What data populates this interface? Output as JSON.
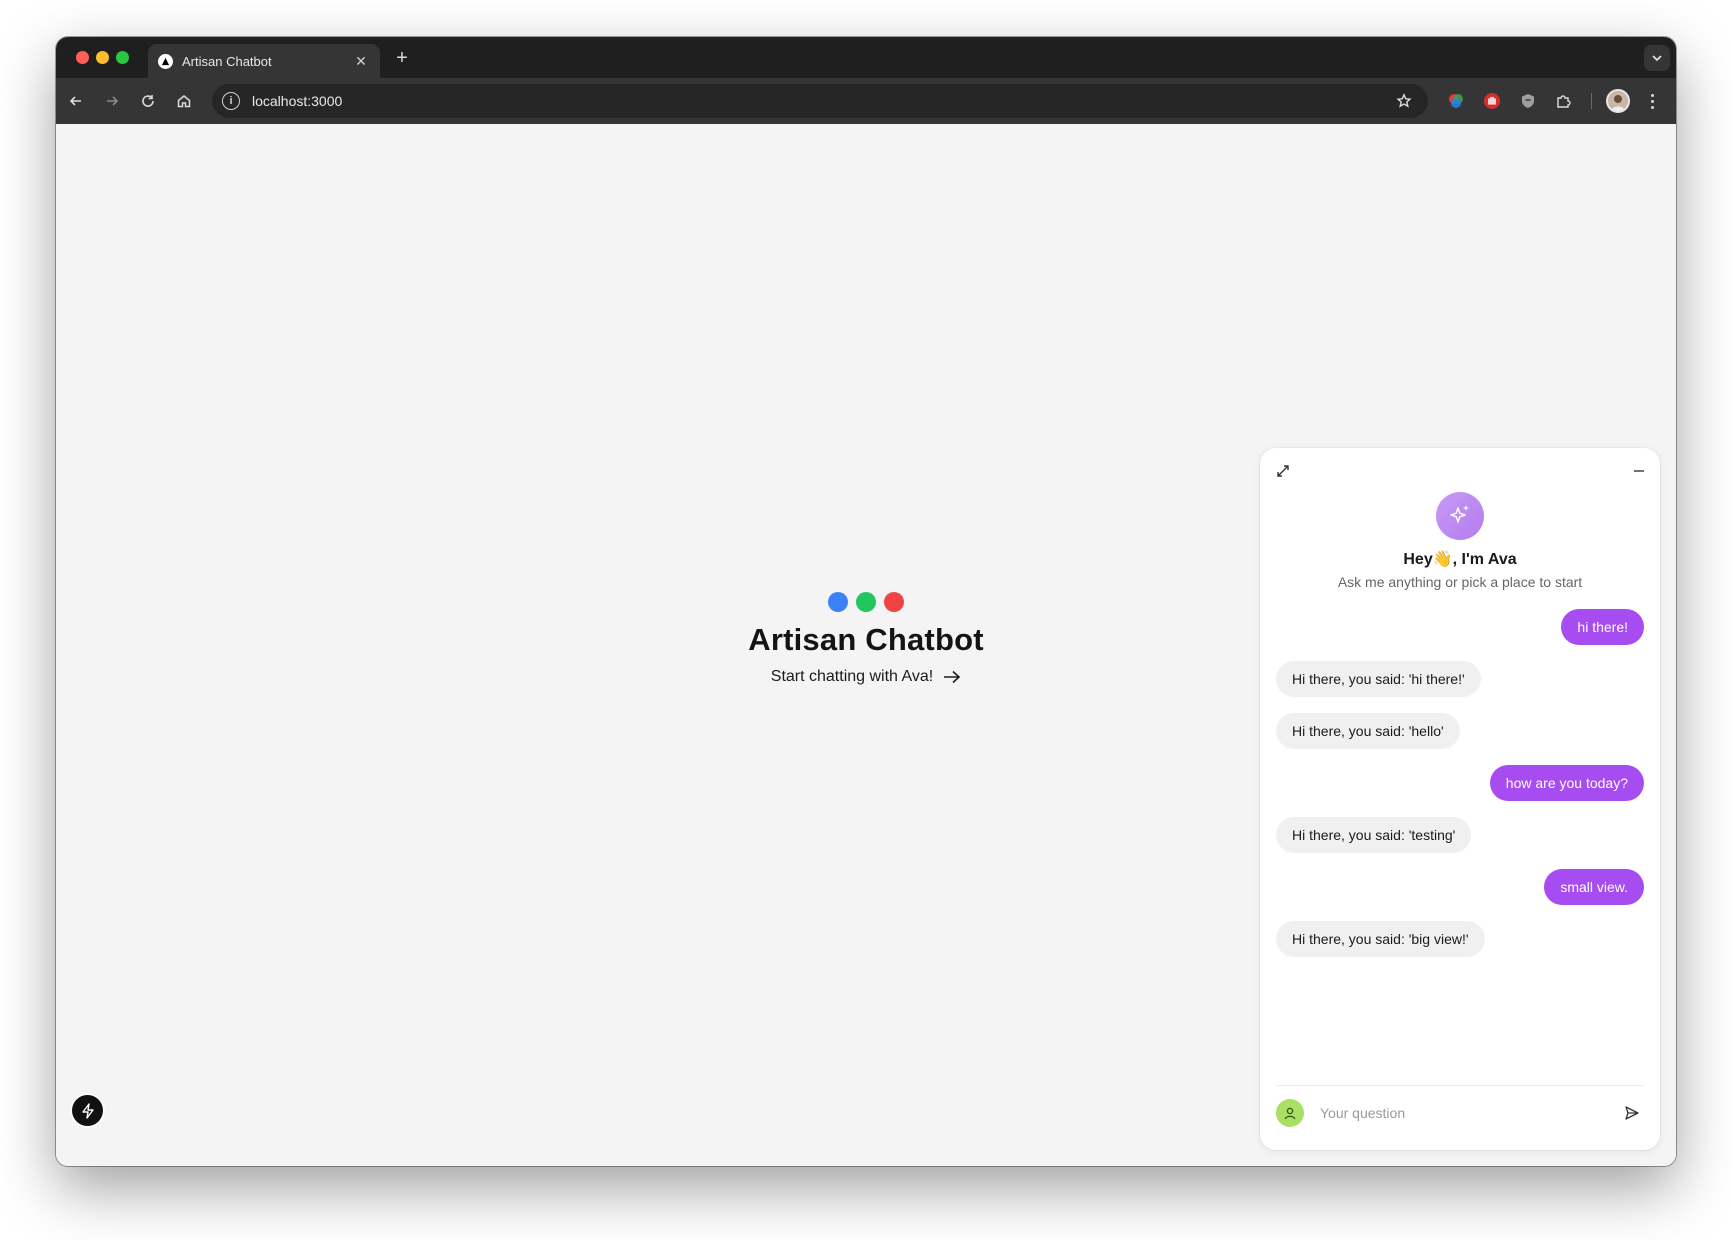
{
  "browser": {
    "tab": {
      "title": "Artisan Chatbot",
      "close_glyph": "✕"
    },
    "new_tab_glyph": "+",
    "address": {
      "url": "localhost:3000"
    },
    "extensions": [
      "color-picker-extension-icon",
      "stop-hand-extension-icon",
      "shield-extension-icon",
      "puzzle-extensions-icon"
    ]
  },
  "page": {
    "dots_colors": [
      "#3b82f6",
      "#22c55e",
      "#ef4444"
    ],
    "title": "Artisan Chatbot",
    "cta": "Start chatting with Ava!"
  },
  "chat": {
    "greeting": "Hey👋, I'm Ava",
    "subtitle": "Ask me anything or pick a place to start",
    "accent_color": "#a64cf0",
    "messages": [
      {
        "role": "user",
        "text": "hi there!"
      },
      {
        "role": "bot",
        "text": "Hi there, you said: 'hi there!'"
      },
      {
        "role": "bot",
        "text": "Hi there, you said: 'hello'"
      },
      {
        "role": "user",
        "text": "how are you today?"
      },
      {
        "role": "bot",
        "text": "Hi there, you said: 'testing'"
      },
      {
        "role": "user",
        "text": "small view."
      },
      {
        "role": "bot",
        "text": "Hi there, you said: 'big view!'"
      }
    ],
    "input": {
      "placeholder": "Your question",
      "value": ""
    }
  }
}
